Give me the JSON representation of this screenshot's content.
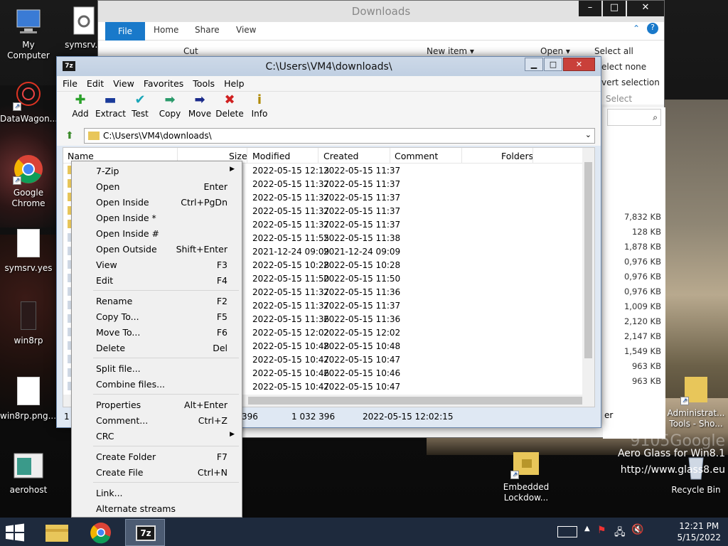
{
  "desktop": {
    "icons": [
      {
        "label": "My Computer"
      },
      {
        "label": "symsrv.d"
      },
      {
        "label": "DataWagon..."
      },
      {
        "label": "Google Chrome"
      },
      {
        "label": "symsrv.yes"
      },
      {
        "label": "win8rp"
      },
      {
        "label": "win8rp.png...."
      },
      {
        "label": "aerohost"
      },
      {
        "label": "Embedded Lockdow..."
      },
      {
        "label": "Administrat... Tools - Sho..."
      },
      {
        "label": "Recycle Bin"
      }
    ],
    "watermark_brand": "9105Google",
    "watermark_line1": "Aero Glass for Win8.1",
    "watermark_line2": "http://www.glass8.eu"
  },
  "explorer": {
    "title": "Downloads",
    "tabs": [
      "File",
      "Home",
      "Share",
      "View"
    ],
    "ribbon": {
      "cut": "Cut",
      "new_item": "New item ▾",
      "open": "Open ▾",
      "select_all": "Select all",
      "select_none": "elect none",
      "invert_selection": "vert selection",
      "select_group": "Select"
    },
    "sizes": [
      "7,832 KB",
      "128 KB",
      "1,878 KB",
      "0,976 KB",
      "0,976 KB",
      "0,976 KB",
      "1,009 KB",
      "2,120 KB",
      "2,147 KB",
      "1,549 KB",
      "963 KB",
      "963 KB"
    ],
    "status_tail": "er"
  },
  "zip": {
    "title": "C:\\Users\\VM4\\downloads\\",
    "menu": [
      "File",
      "Edit",
      "View",
      "Favorites",
      "Tools",
      "Help"
    ],
    "toolbar": [
      {
        "label": "Add",
        "icon": "plus-icon",
        "glyph": "✚",
        "color": "#2aa12a"
      },
      {
        "label": "Extract",
        "icon": "minus-icon",
        "glyph": "▬",
        "color": "#1a3a9a"
      },
      {
        "label": "Test",
        "icon": "check-icon",
        "glyph": "✔",
        "color": "#1aa6b8"
      },
      {
        "label": "Copy",
        "icon": "double-arrow-icon",
        "glyph": "➡",
        "color": "#2a9a6a"
      },
      {
        "label": "Move",
        "icon": "arrow-right-icon",
        "glyph": "➡",
        "color": "#1a2a8a"
      },
      {
        "label": "Delete",
        "icon": "x-icon",
        "glyph": "✖",
        "color": "#d02020"
      },
      {
        "label": "Info",
        "icon": "info-icon",
        "glyph": "i",
        "color": "#b08a00"
      }
    ],
    "address": "C:\\Users\\VM4\\downloads\\",
    "columns": {
      "name": "Name",
      "size": "Size",
      "modified": "Modified",
      "created": "Created",
      "comment": "Comment",
      "folders": "Folders"
    },
    "rows": [
      {
        "modified": "2022-05-15 12:13",
        "created": "2022-05-15 11:37"
      },
      {
        "modified": "2022-05-15 11:37",
        "created": "2022-05-15 11:37"
      },
      {
        "modified": "2022-05-15 11:37",
        "created": "2022-05-15 11:37"
      },
      {
        "modified": "2022-05-15 11:37",
        "created": "2022-05-15 11:37"
      },
      {
        "modified": "2022-05-15 11:37",
        "created": "2022-05-15 11:37"
      },
      {
        "modified": "2022-05-15 11:55",
        "created": "2022-05-15 11:38"
      },
      {
        "modified": "2021-12-24 09:09",
        "created": "2021-12-24 09:09"
      },
      {
        "modified": "2022-05-15 10:28",
        "created": "2022-05-15 10:28"
      },
      {
        "modified": "2022-05-15 11:50",
        "created": "2022-05-15 11:50"
      },
      {
        "modified": "2022-05-15 11:37",
        "created": "2022-05-15 11:36"
      },
      {
        "modified": "2022-05-15 11:37",
        "created": "2022-05-15 11:37"
      },
      {
        "modified": "2022-05-15 11:36",
        "created": "2022-05-15 11:36"
      },
      {
        "modified": "2022-05-15 12:02",
        "created": "2022-05-15 12:02"
      },
      {
        "modified": "2022-05-15 10:48",
        "created": "2022-05-15 10:48"
      },
      {
        "modified": "2022-05-15 10:47",
        "created": "2022-05-15 10:47"
      },
      {
        "modified": "2022-05-15 10:46",
        "created": "2022-05-15 10:46"
      },
      {
        "modified": "2022-05-15 10:47",
        "created": "2022-05-15 10:47"
      }
    ],
    "status": {
      "sel": "1 /",
      "a": "396",
      "b": "1 032 396",
      "c": "2022-05-15 12:02:15"
    }
  },
  "context_menu": {
    "items": [
      {
        "label": "7-Zip",
        "key": "",
        "submenu": true
      },
      {
        "label": "Open",
        "key": "Enter"
      },
      {
        "label": "Open Inside",
        "key": "Ctrl+PgDn"
      },
      {
        "label": "Open Inside *",
        "key": ""
      },
      {
        "label": "Open Inside #",
        "key": ""
      },
      {
        "label": "Open Outside",
        "key": "Shift+Enter"
      },
      {
        "label": "View",
        "key": "F3"
      },
      {
        "label": "Edit",
        "key": "F4"
      },
      {
        "label": "Rename",
        "key": "F2"
      },
      {
        "label": "Copy To...",
        "key": "F5"
      },
      {
        "label": "Move To...",
        "key": "F6"
      },
      {
        "label": "Delete",
        "key": "Del"
      },
      {
        "label": "Split file...",
        "key": ""
      },
      {
        "label": "Combine files...",
        "key": ""
      },
      {
        "label": "Properties",
        "key": "Alt+Enter"
      },
      {
        "label": "Comment...",
        "key": "Ctrl+Z"
      },
      {
        "label": "CRC",
        "key": "",
        "submenu": true
      },
      {
        "label": "Create Folder",
        "key": "F7"
      },
      {
        "label": "Create File",
        "key": "Ctrl+N"
      },
      {
        "label": "Link...",
        "key": ""
      },
      {
        "label": "Alternate streams",
        "key": ""
      }
    ]
  },
  "taskbar": {
    "time": "12:21 PM",
    "date": "5/15/2022"
  },
  "colors": {
    "taskbar": "#1e2a3d",
    "accent": "#1979ca",
    "close_red": "#c9403a"
  }
}
